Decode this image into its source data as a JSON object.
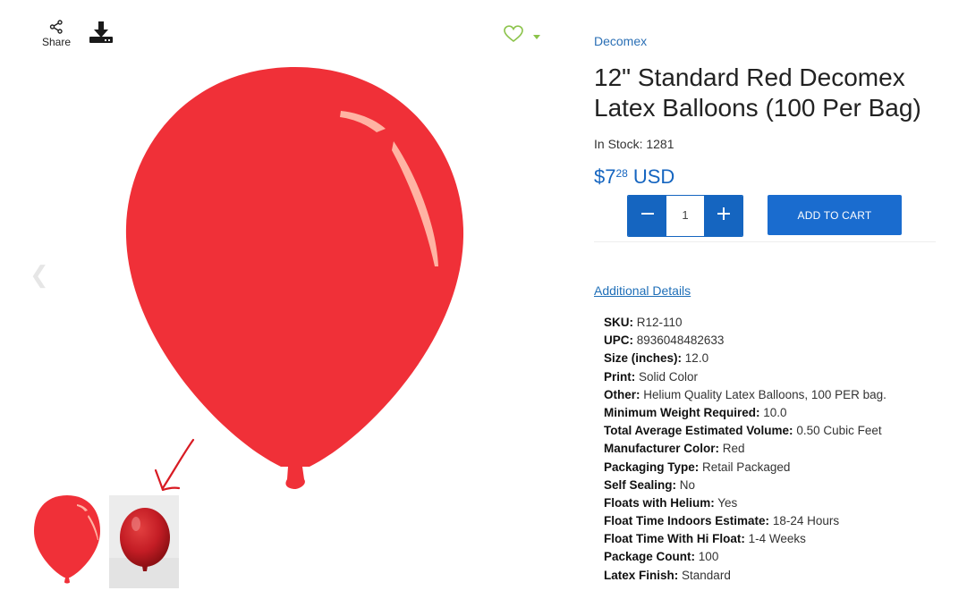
{
  "toolbar": {
    "share_label": "Share",
    "share_icon": "share-icon",
    "download_icon": "download-icon",
    "wishlist_icon": "heart-icon",
    "wishlist_dropdown_icon": "caret-down-icon"
  },
  "gallery": {
    "prev_icon": "chevron-left-icon",
    "main_image": "red-balloon",
    "thumbnails": [
      "red-balloon-illustration",
      "red-balloon-photo"
    ],
    "annotation": "red-arrow"
  },
  "product": {
    "brand": "Decomex",
    "title": "12\" Standard Red Decomex Latex Balloons (100 Per Bag)",
    "stock_label": "In Stock:",
    "stock_count": "1281",
    "price_symbol": "$",
    "price_dollars": "7",
    "price_cents": "28",
    "currency": "USD",
    "quantity": "1",
    "add_to_cart": "ADD TO CART"
  },
  "details": {
    "link": "Additional Details",
    "specs": [
      {
        "key": "SKU:",
        "value": "R12-110"
      },
      {
        "key": "UPC:",
        "value": "8936048482633"
      },
      {
        "key": "Size (inches):",
        "value": "12.0"
      },
      {
        "key": "Print:",
        "value": "Solid Color"
      },
      {
        "key": "Other:",
        "value": "Helium Quality Latex Balloons, 100 PER bag."
      },
      {
        "key": "Minimum Weight Required:",
        "value": "10.0"
      },
      {
        "key": "Total Average Estimated Volume:",
        "value": "0.50 Cubic Feet"
      },
      {
        "key": "Manufacturer Color:",
        "value": "Red"
      },
      {
        "key": "Packaging Type:",
        "value": "Retail Packaged"
      },
      {
        "key": "Self Sealing:",
        "value": "No"
      },
      {
        "key": "Floats with Helium:",
        "value": "Yes"
      },
      {
        "key": "Float Time Indoors Estimate:",
        "value": "18-24 Hours"
      },
      {
        "key": "Float Time With Hi Float:",
        "value": "1-4 Weeks"
      },
      {
        "key": "Package Count:",
        "value": "100"
      },
      {
        "key": "Latex Finish:",
        "value": "Standard"
      }
    ]
  },
  "colors": {
    "accent": "#1565c0",
    "balloon": "#f03038",
    "wishlist": "#8bc34a",
    "annotation": "#d81b23"
  }
}
